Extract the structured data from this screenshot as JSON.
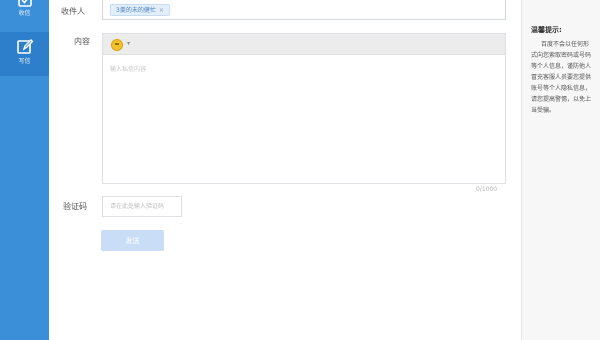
{
  "sidebar": {
    "items": [
      {
        "label": "收信",
        "icon": "inbox-icon"
      },
      {
        "label": "写信",
        "icon": "pencil-icon"
      }
    ],
    "accent": "#3b8ed8"
  },
  "form": {
    "recipient_label": "收件人",
    "recipient_chip": "3羹的未的健忙",
    "content_label": "内容",
    "content_placeholder": "输入私信内容",
    "char_count": "0/1000",
    "captcha_label": "验证码",
    "captcha_placeholder": "请在此处输入验证码",
    "send_label": "发送"
  },
  "tips": {
    "title": "温馨提示:",
    "body": "百度不会以任何形式向您索取密码或号码等个人信息，谨防他人冒充客服人员要您提供账号等个人隐私信息，请您提高警惕，以免上当受骗。"
  }
}
